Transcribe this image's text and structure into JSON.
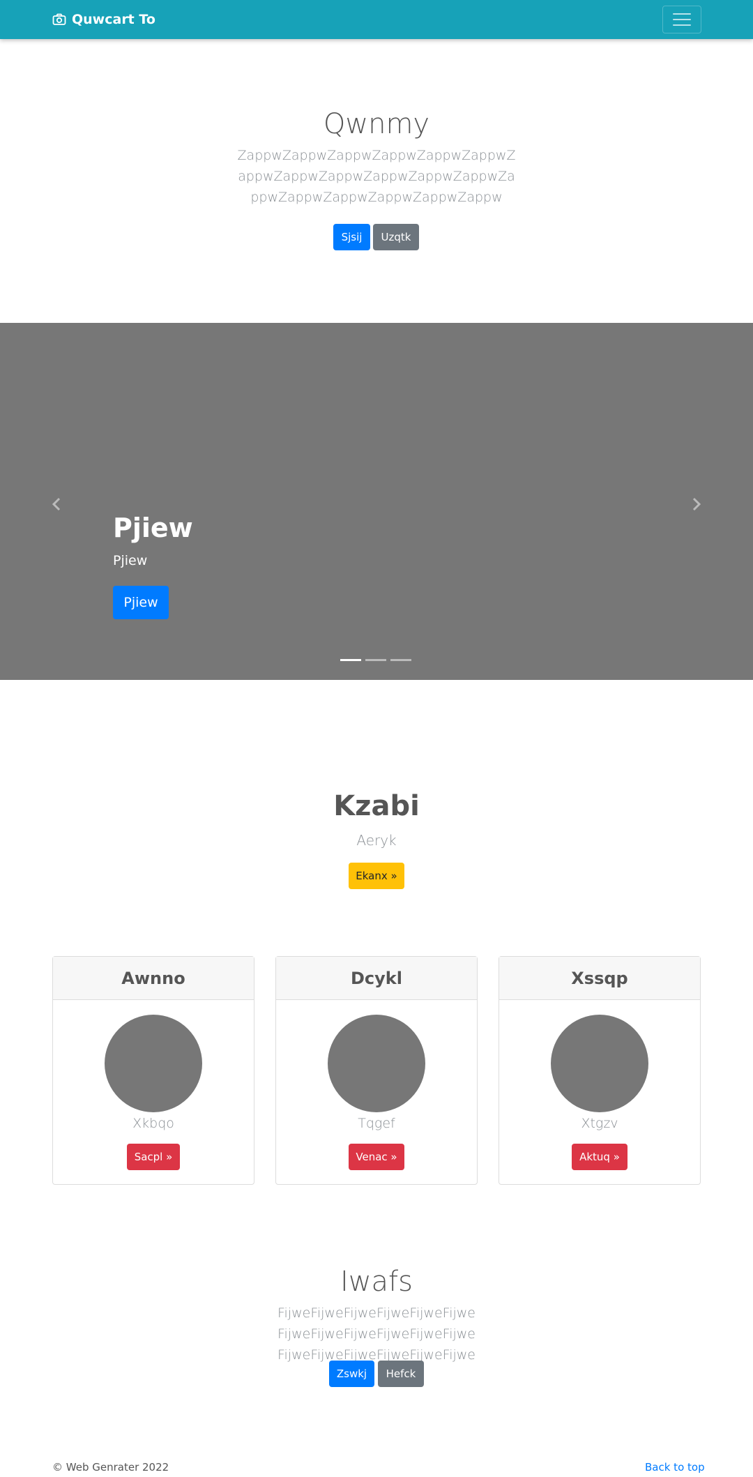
{
  "navbar": {
    "brand": "Quwcart To",
    "brand_icon": "camera-icon",
    "toggler_icon": "hamburger-icon"
  },
  "hero": {
    "title": "Qwnmy",
    "text": "ZappwZappwZappwZappwZappwZappwZappwZappwZappwZappwZappwZappwZappwZappwZappwZappwZappwZappw",
    "primary_button": "Sjsij",
    "secondary_button": "Uzqtk"
  },
  "carousel": {
    "caption_title": "Pjiew",
    "caption_text": "Pjiew",
    "caption_button": "Pjiew",
    "prev_icon": "chevron-left-icon",
    "next_icon": "chevron-right-icon",
    "slide_count": 3,
    "active_slide": 1
  },
  "section": {
    "title": "Kzabi",
    "subtitle": "Aeryk",
    "button": "Ekanx »"
  },
  "cards": [
    {
      "title": "Awnno",
      "label": "Xkbqo",
      "button": "Sacpl »"
    },
    {
      "title": "Dcykl",
      "label": "Tqgef",
      "button": "Venac »"
    },
    {
      "title": "Xssqp",
      "label": "Xtgzv",
      "button": "Aktuq »"
    }
  ],
  "bottom": {
    "title": "Iwafs",
    "text": "FijweFijweFijweFijweFijweFijwe FijweFijweFijweFijweFijweFijwe FijweFijweFijweFijweFijweFijwe",
    "primary_button": "Zswkj",
    "secondary_button": "Hefck"
  },
  "footer": {
    "copyright": "© Web Genrater 2022",
    "back_to_top": "Back to top"
  },
  "colors": {
    "navbar": "#17a2b8",
    "primary": "#007bff",
    "secondary": "#6c757d",
    "danger": "#dc3545",
    "warning": "#ffc107",
    "placeholder": "#777777"
  }
}
